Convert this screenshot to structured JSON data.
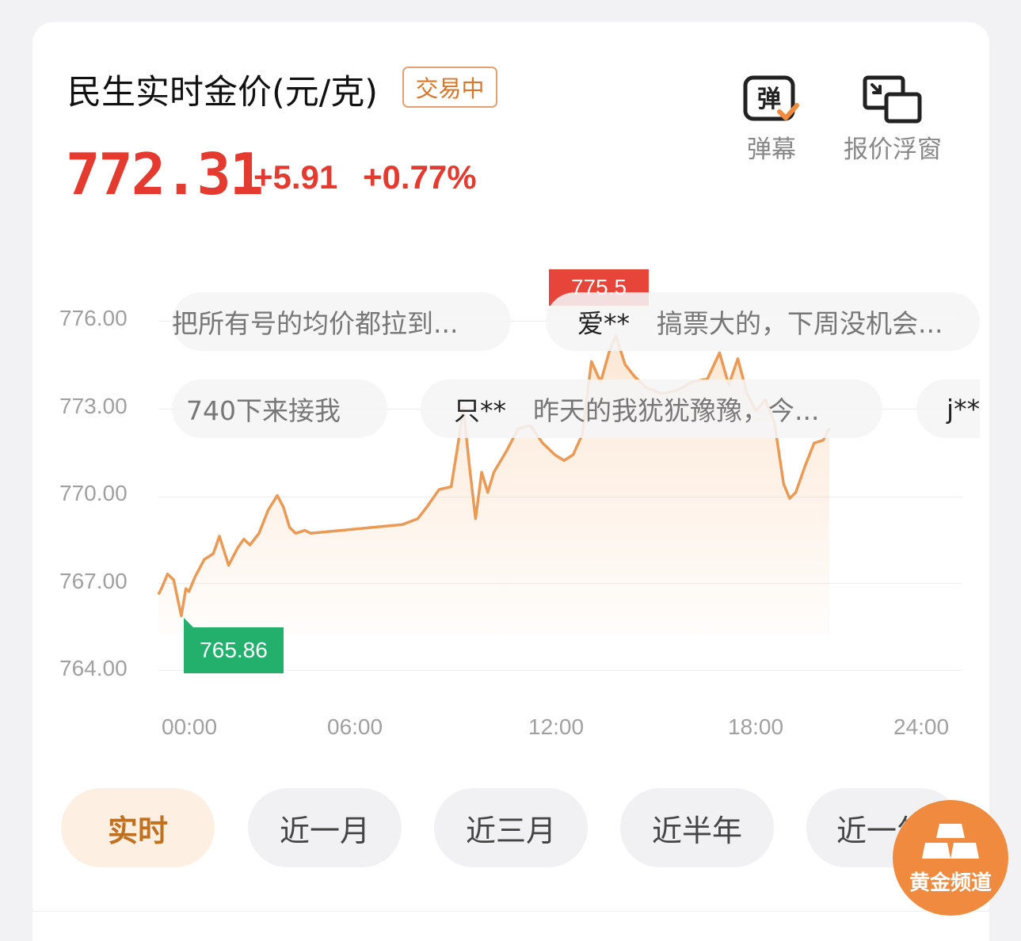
{
  "header": {
    "title": "民生实时金价(元/克)",
    "status": "交易中",
    "price": "772.31",
    "change": "+5.91",
    "change_pct": "+0.77%"
  },
  "toolbar": {
    "danmaku_label": "弹幕",
    "float_label": "报价浮窗"
  },
  "colors": {
    "price_up": "#e53a2f",
    "line": "#eb9a56",
    "high_marker": "#e8453a",
    "low_marker": "#22b06c",
    "accent": "#ef8a3e"
  },
  "chart_data": {
    "type": "line",
    "y_ticks": [
      "776.00",
      "773.00",
      "770.00",
      "767.00",
      "764.00"
    ],
    "x_ticks": [
      "00:00",
      "06:00",
      "12:00",
      "18:00",
      "24:00"
    ],
    "ylim": [
      764,
      776
    ],
    "xlim": [
      0,
      24
    ],
    "high_label": "775.5",
    "low_label": "765.86",
    "series": [
      {
        "x": [
          0,
          0.1,
          0.3,
          0.5,
          0.6,
          0.75,
          0.9,
          1.0,
          1.2,
          1.5,
          1.8,
          2.0,
          2.3,
          2.6,
          2.8,
          3.0,
          3.3,
          3.6,
          3.9,
          4.1,
          4.3,
          4.5,
          4.8,
          5.0,
          5.5,
          6.0,
          7.0,
          8.0,
          8.5,
          8.8,
          9.2,
          9.6,
          9.8,
          10.0,
          10.2,
          10.4,
          10.6,
          10.8,
          11.0,
          11.4,
          11.8,
          12.2,
          12.6,
          13.0,
          13.3,
          13.6,
          13.9,
          14.2,
          14.5,
          14.8,
          15.0,
          15.3,
          15.6,
          16.0,
          16.5,
          17.0,
          17.5,
          18.0,
          18.4,
          18.7,
          19.0,
          19.3,
          19.6,
          19.9,
          20.2,
          20.5,
          20.7,
          20.9,
          21.2,
          21.5,
          21.8,
          22.0
        ],
        "y": [
          766.6,
          766.8,
          767.3,
          767.1,
          766.6,
          765.86,
          766.8,
          766.7,
          767.2,
          767.8,
          768.0,
          768.6,
          767.6,
          768.2,
          768.5,
          768.3,
          768.7,
          769.5,
          770.0,
          769.6,
          768.9,
          768.7,
          768.8,
          768.7,
          768.75,
          768.8,
          768.9,
          769.0,
          769.2,
          769.6,
          770.2,
          770.3,
          771.6,
          773.0,
          771.0,
          769.2,
          770.8,
          770.1,
          770.8,
          771.5,
          772.3,
          772.4,
          771.8,
          771.4,
          771.2,
          771.4,
          772.1,
          774.6,
          773.9,
          775.0,
          775.5,
          774.5,
          774.1,
          773.7,
          773.5,
          773.6,
          773.9,
          774.0,
          774.9,
          773.8,
          774.7,
          773.5,
          772.9,
          773.3,
          772.5,
          770.4,
          769.9,
          770.1,
          771.0,
          771.8,
          771.9,
          772.31
        ]
      }
    ]
  },
  "danmaku": [
    {
      "user": "",
      "text": "把所有号的均价都拉到..."
    },
    {
      "user": "爱**",
      "text": "搞票大的，下周没机会..."
    },
    {
      "user": "",
      "text": "740下来接我"
    },
    {
      "user": "只**",
      "text": "昨天的我犹犹豫豫，今..."
    },
    {
      "user": "j**",
      "text": ""
    }
  ],
  "tabs": [
    "实时",
    "近一月",
    "近三月",
    "近半年",
    "近一年"
  ],
  "fab": {
    "label": "黄金频道"
  }
}
